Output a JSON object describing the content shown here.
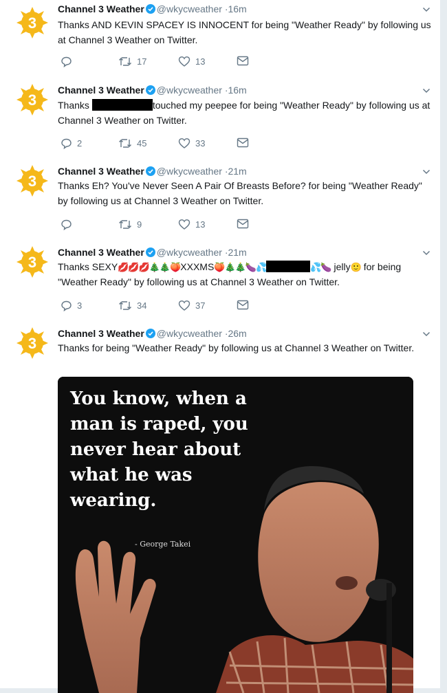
{
  "account": {
    "name": "Channel 3 Weather",
    "handle": "@wkycweather",
    "separator": "·"
  },
  "colors": {
    "avatar_sun": "#f5b81a",
    "verified": "#1da1f2",
    "text": "#14171a",
    "muted": "#657786"
  },
  "tweets": [
    {
      "time": "16m",
      "text": "Thanks AND KEVIN SPACEY IS INNOCENT for being \"Weather Ready\" by following us at Channel 3 Weather on Twitter.",
      "replies": "",
      "retweets": "17",
      "likes": "13"
    },
    {
      "time": "16m",
      "text_before": "Thanks ",
      "text_after": "touched my peepee for being \"Weather Ready\" by following us at Channel 3 Weather on Twitter.",
      "replies": "2",
      "retweets": "45",
      "likes": "33"
    },
    {
      "time": "21m",
      "text": "Thanks Eh? You've Never Seen A Pair Of Breasts Before? for being \"Weather Ready\" by following us at Channel 3 Weather on Twitter.",
      "replies": "",
      "retweets": "9",
      "likes": "13"
    },
    {
      "time": "21m",
      "text_a": "Thanks SEXY",
      "emoji_a": "💋💋💋🎄🎄🍑",
      "text_b": "XXXMS",
      "emoji_b": "🍑🎄🎄🍆💦",
      "emoji_c": "💦🍆",
      "text_c": "jelly",
      "emoji_d": "🙂",
      "text_d": " for being \"Weather Ready\" by following us at Channel 3 Weather on Twitter.",
      "replies": "3",
      "retweets": "34",
      "likes": "37"
    },
    {
      "time": "26m",
      "text": "Thanks  for being \"Weather Ready\" by following us at Channel 3 Weather on Twitter.",
      "media": {
        "quote": "You know, when a man is raped, you never hear about what he was wearing.",
        "attribution": "- George Takei"
      }
    }
  ]
}
